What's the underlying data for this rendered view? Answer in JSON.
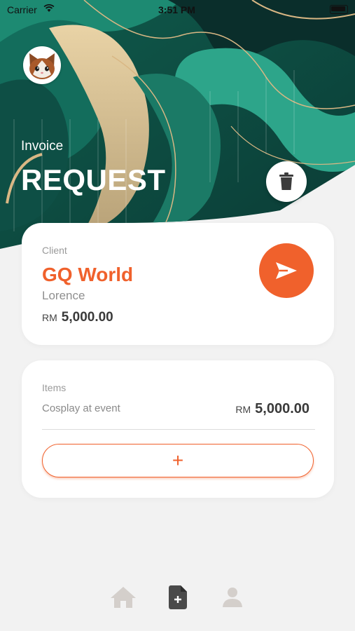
{
  "status_bar": {
    "carrier": "Carrier",
    "time": "3:51 PM"
  },
  "header": {
    "subtitle": "Invoice",
    "title": "REQUEST"
  },
  "client_card": {
    "label": "Client",
    "name": "GQ World",
    "contact": "Lorence",
    "currency": "RM",
    "amount": "5,000.00"
  },
  "items_card": {
    "label": "Items",
    "items": [
      {
        "description": "Cosplay at event",
        "currency": "RM",
        "amount": "5,000.00"
      }
    ],
    "add_label": "+"
  },
  "icons": {
    "avatar": "cat-avatar-icon",
    "delete": "trash-icon",
    "send": "send-icon",
    "nav": [
      "home-icon",
      "new-document-icon",
      "profile-icon"
    ]
  },
  "colors": {
    "accent": "#f0612c",
    "background": "#f2f2f2",
    "card": "#ffffff",
    "nav_inactive": "#d4cfcb",
    "nav_active": "#4a4a4a"
  }
}
